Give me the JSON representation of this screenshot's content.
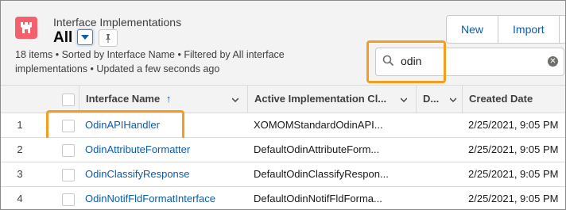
{
  "header": {
    "object_type": "Interface Implementations",
    "view_name": "All",
    "meta_line1": "18 items • Sorted by Interface Name • Filtered by All interface",
    "meta_line2": "implementations • Updated a few seconds ago"
  },
  "actions": {
    "new_label": "New",
    "import_label": "Import"
  },
  "search": {
    "value": "odin"
  },
  "table": {
    "columns": [
      {
        "label": "Interface Name",
        "sort": "↑"
      },
      {
        "label": "Active Implementation Cl..."
      },
      {
        "label": "D..."
      },
      {
        "label": "Created Date"
      }
    ],
    "rows": [
      {
        "num": "1",
        "name": "OdinAPIHandler",
        "impl": "XOMOMStandardOdinAPI...",
        "date": "2/25/2021, 9:05 PM"
      },
      {
        "num": "2",
        "name": "OdinAttributeFormatter",
        "impl": "DefaultOdinAttributeForm...",
        "date": "2/25/2021, 9:05 PM"
      },
      {
        "num": "3",
        "name": "OdinClassifyResponse",
        "impl": "DefaultOdinClassifyRespon...",
        "date": "2/25/2021, 9:05 PM"
      },
      {
        "num": "4",
        "name": "OdinNotifFldFormatInterface",
        "impl": "DefaultOdinNotifFldForma...",
        "date": "2/25/2021, 9:05 PM"
      }
    ]
  },
  "colors": {
    "brand_icon": "#f4606c",
    "link": "#0b5cab",
    "highlight": "#f59d1f"
  }
}
